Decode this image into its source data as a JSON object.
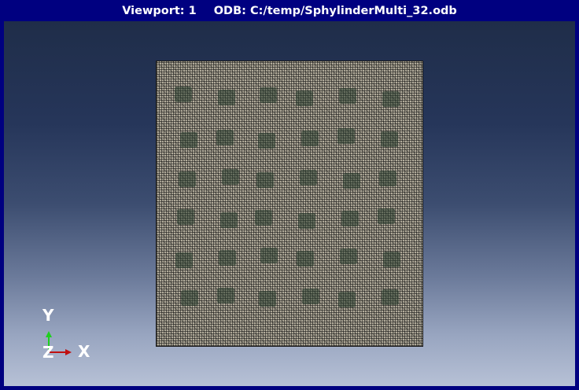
{
  "viewport": {
    "label": "Viewport: 1",
    "odb_label": "ODB: C:/temp/SphylinderMulti_32.odb"
  },
  "mesh": {
    "description_color": "#b3ad9c",
    "inclusion_color": "#2c3c30"
  },
  "triad": {
    "y_label": "Y",
    "x_label": "X",
    "z_label": "Z",
    "y_color": "#1ed01e",
    "x_color": "#c01010"
  },
  "colors": {
    "frame": "#000080",
    "background_top": "#1f2d49",
    "background_bottom": "#b7c1d6"
  }
}
